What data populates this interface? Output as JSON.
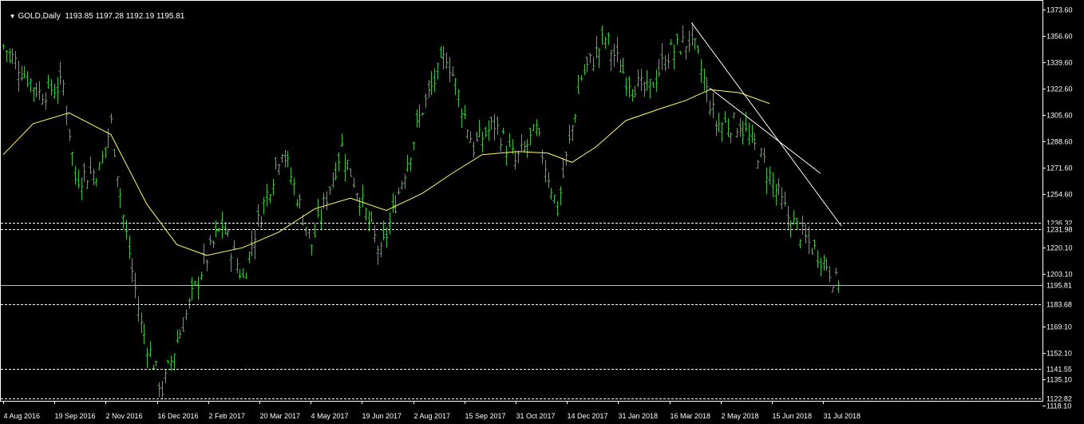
{
  "header": {
    "menu_icon": "triangle-down-icon",
    "symbol": "GOLD,Daily",
    "ohlc": "1193.85 1197.28 1192.19 1195.81"
  },
  "colors": {
    "background": "#000000",
    "bars": "#3fbf3f",
    "moving_average": "#ffff66",
    "trendline": "#ffffff",
    "level_lines": "#ffffff",
    "axis_text": "#ffffff"
  },
  "chart_data": {
    "type": "ohlc",
    "timeframe": "Daily",
    "ylim": [
      1118.1,
      1375.0
    ],
    "y_ticks": [
      1373.6,
      1356.6,
      1339.6,
      1322.6,
      1305.6,
      1288.6,
      1271.6,
      1254.6,
      1220.1,
      1203.1,
      1169.1,
      1152.1,
      1135.1,
      1118.1
    ],
    "x_ticks": [
      "4 Aug 2016",
      "19 Sep 2016",
      "2 Nov 2016",
      "16 Dec 2016",
      "2 Feb 2017",
      "20 Mar 2017",
      "4 May 2017",
      "19 Jun 2017",
      "2 Aug 2017",
      "15 Sep 2017",
      "31 Oct 2017",
      "14 Dec 2017",
      "31 Jan 2018",
      "16 Mar 2018",
      "2 May 2018",
      "15 Jun 2018",
      "31 Jul 2018"
    ],
    "last_price": 1195.81,
    "last_price_label": "1195.81",
    "horizontal_levels": [
      {
        "value": 1236.32,
        "label": "1236.32"
      },
      {
        "value": 1231.98,
        "label": "1231.98"
      },
      {
        "value": 1183.68,
        "label": "1183.68"
      },
      {
        "value": 1141.55,
        "label": "1141.55"
      },
      {
        "value": 1122.82,
        "label": "1122.82"
      }
    ],
    "trendlines": [
      {
        "from": {
          "bar": 230,
          "price": 1365
        },
        "to": {
          "bar": 280,
          "price": 1234
        }
      },
      {
        "from": {
          "bar": 236,
          "price": 1323
        },
        "to": {
          "bar": 273,
          "price": 1268
        }
      }
    ],
    "close_path": [
      {
        "bar": 0,
        "price": 1350
      },
      {
        "bar": 12,
        "price": 1320
      },
      {
        "bar": 20,
        "price": 1325
      },
      {
        "bar": 24,
        "price": 1265
      },
      {
        "bar": 32,
        "price": 1270
      },
      {
        "bar": 36,
        "price": 1300
      },
      {
        "bar": 40,
        "price": 1240
      },
      {
        "bar": 46,
        "price": 1170
      },
      {
        "bar": 53,
        "price": 1128
      },
      {
        "bar": 58,
        "price": 1160
      },
      {
        "bar": 66,
        "price": 1205
      },
      {
        "bar": 73,
        "price": 1235
      },
      {
        "bar": 80,
        "price": 1200
      },
      {
        "bar": 84,
        "price": 1230
      },
      {
        "bar": 93,
        "price": 1285
      },
      {
        "bar": 103,
        "price": 1222
      },
      {
        "bar": 113,
        "price": 1285
      },
      {
        "bar": 126,
        "price": 1215
      },
      {
        "bar": 134,
        "price": 1270
      },
      {
        "bar": 140,
        "price": 1310
      },
      {
        "bar": 148,
        "price": 1345
      },
      {
        "bar": 157,
        "price": 1285
      },
      {
        "bar": 164,
        "price": 1300
      },
      {
        "bar": 171,
        "price": 1275
      },
      {
        "bar": 178,
        "price": 1295
      },
      {
        "bar": 185,
        "price": 1245
      },
      {
        "bar": 193,
        "price": 1330
      },
      {
        "bar": 201,
        "price": 1355
      },
      {
        "bar": 208,
        "price": 1330
      },
      {
        "bar": 215,
        "price": 1320
      },
      {
        "bar": 222,
        "price": 1345
      },
      {
        "bar": 230,
        "price": 1355
      },
      {
        "bar": 238,
        "price": 1300
      },
      {
        "bar": 246,
        "price": 1300
      },
      {
        "bar": 254,
        "price": 1275
      },
      {
        "bar": 262,
        "price": 1240
      },
      {
        "bar": 268,
        "price": 1225
      },
      {
        "bar": 275,
        "price": 1210
      },
      {
        "bar": 279,
        "price": 1193
      }
    ],
    "moving_average_path": [
      {
        "bar": 0,
        "price": 1280
      },
      {
        "bar": 10,
        "price": 1300
      },
      {
        "bar": 22,
        "price": 1307
      },
      {
        "bar": 36,
        "price": 1293
      },
      {
        "bar": 48,
        "price": 1248
      },
      {
        "bar": 58,
        "price": 1222
      },
      {
        "bar": 68,
        "price": 1215
      },
      {
        "bar": 80,
        "price": 1220
      },
      {
        "bar": 92,
        "price": 1230
      },
      {
        "bar": 104,
        "price": 1245
      },
      {
        "bar": 116,
        "price": 1252
      },
      {
        "bar": 128,
        "price": 1244
      },
      {
        "bar": 140,
        "price": 1255
      },
      {
        "bar": 150,
        "price": 1268
      },
      {
        "bar": 160,
        "price": 1280
      },
      {
        "bar": 172,
        "price": 1282
      },
      {
        "bar": 182,
        "price": 1281
      },
      {
        "bar": 190,
        "price": 1275
      },
      {
        "bar": 198,
        "price": 1285
      },
      {
        "bar": 208,
        "price": 1302
      },
      {
        "bar": 220,
        "price": 1310
      },
      {
        "bar": 228,
        "price": 1315
      },
      {
        "bar": 236,
        "price": 1322
      },
      {
        "bar": 246,
        "price": 1320
      },
      {
        "bar": 256,
        "price": 1313
      }
    ],
    "total_bars": 280,
    "grid": false
  }
}
